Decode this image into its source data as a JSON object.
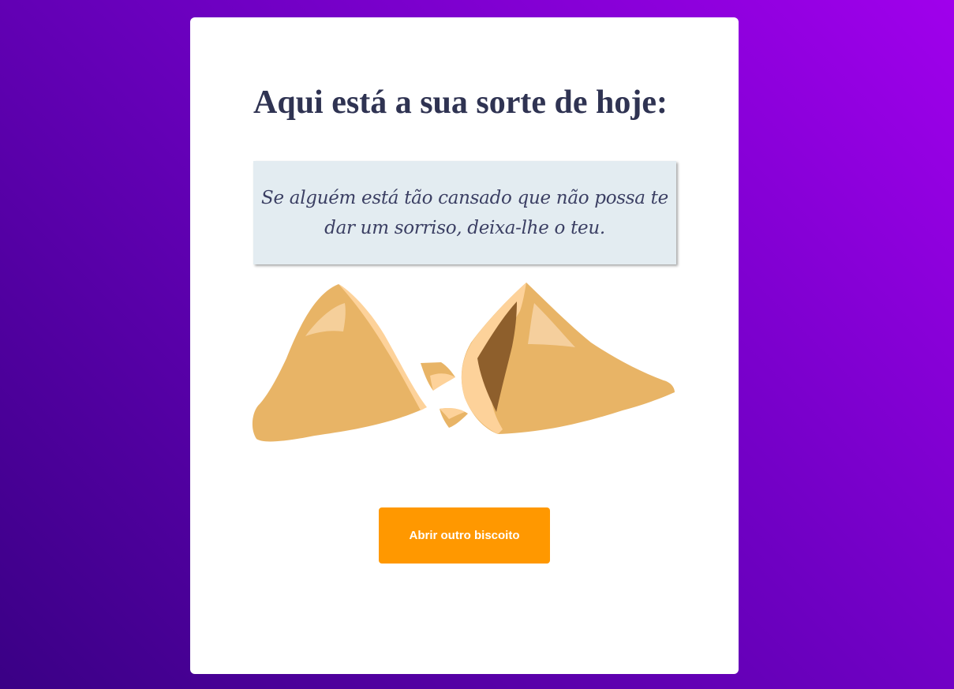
{
  "page": {
    "heading": "Aqui está a sua sorte de hoje:",
    "fortune": "Se alguém está tão cansado que não possa te dar um sorriso, deixa-lhe o teu.",
    "button_label": "Abrir outro biscoito"
  },
  "illustration": {
    "icon": "fortune-cookie-icon",
    "colors": {
      "dough": "#e8b466",
      "highlight": "#fdd29a",
      "inside": "#8e5f2c"
    }
  },
  "colors": {
    "background_start": "#3a0085",
    "background_end": "#a000ec",
    "card": "#ffffff",
    "heading": "#2f3352",
    "fortune_box": "#e3ecf1",
    "button": "#ff9800"
  }
}
